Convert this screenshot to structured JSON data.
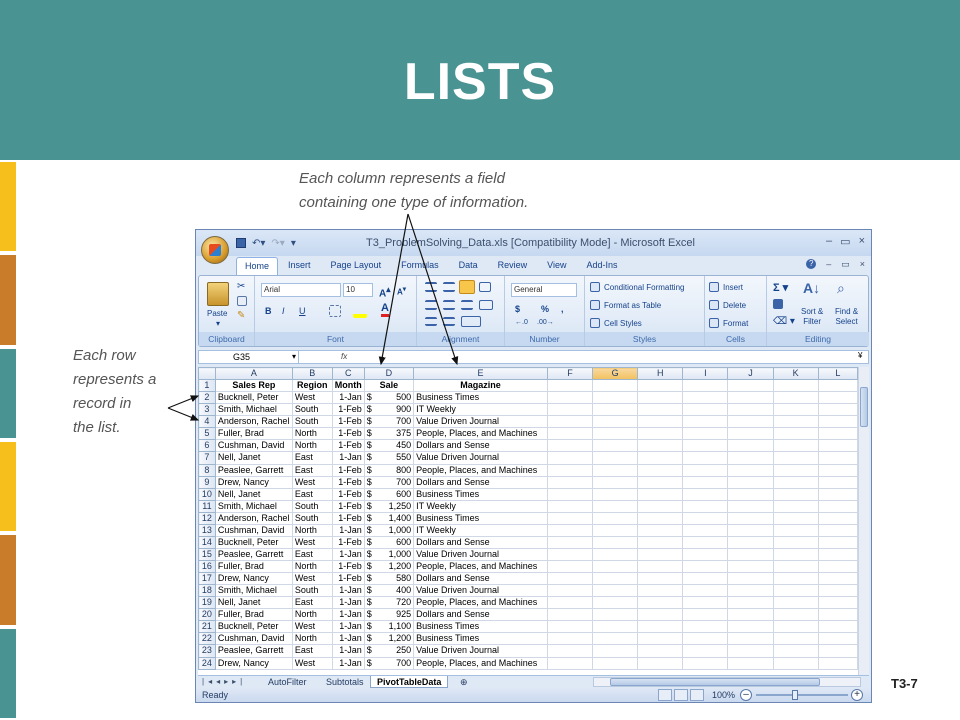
{
  "slide": {
    "title": "LISTS",
    "slide_number": "T3-7",
    "annotation_column": [
      "Each column represents a field",
      "containing one type of information."
    ],
    "annotation_row": [
      "Each row",
      "represents a",
      "record in",
      "the list."
    ],
    "strip_colors": [
      "#f6bf1c",
      "#c97d2b",
      "#4a9393",
      "#f6bf1c",
      "#c97d2b",
      "#4a9393"
    ]
  },
  "window": {
    "title": "T3_ProblemSolving_Data.xls  [Compatibility Mode] - Microsoft Excel",
    "controls": [
      "–",
      "▭",
      "×"
    ]
  },
  "ribbon_tabs": [
    "Home",
    "Insert",
    "Page Layout",
    "Formulas",
    "Data",
    "Review",
    "View",
    "Add-Ins"
  ],
  "ribbon": {
    "clipboard": {
      "label": "Clipboard",
      "paste": "Paste"
    },
    "font": {
      "label": "Font",
      "name": "Arial",
      "size": "10",
      "bold": "B",
      "italic": "I",
      "underline": "U"
    },
    "alignment": {
      "label": "Alignment"
    },
    "number": {
      "label": "Number",
      "format": "General",
      "currency": "$",
      "percent": "%",
      "comma": ","
    },
    "styles": {
      "label": "Styles",
      "items": [
        "Conditional Formatting",
        "Format as Table",
        "Cell Styles"
      ]
    },
    "cells": {
      "label": "Cells",
      "items": [
        "Insert",
        "Delete",
        "Format"
      ]
    },
    "editing": {
      "label": "Editing",
      "sort": [
        "Sort &",
        "Filter"
      ],
      "find": [
        "Find &",
        "Select"
      ]
    }
  },
  "formula_bar": {
    "name_box": "G35",
    "fx": "fx"
  },
  "columns": [
    "A",
    "B",
    "C",
    "D",
    "E",
    "F",
    "G",
    "H",
    "I",
    "J",
    "K",
    "L"
  ],
  "header_row": [
    "Sales Rep",
    "Region",
    "Month",
    "Sale",
    "Magazine"
  ],
  "rows": [
    [
      "Bucknell, Peter",
      "West",
      "1-Jan",
      "500",
      "Business Times"
    ],
    [
      "Smith, Michael",
      "South",
      "1-Feb",
      "900",
      "IT Weekly"
    ],
    [
      "Anderson, Rachel",
      "South",
      "1-Feb",
      "700",
      "Value Driven Journal"
    ],
    [
      "Fuller, Brad",
      "North",
      "1-Feb",
      "375",
      "People, Places, and Machines"
    ],
    [
      "Cushman, David",
      "North",
      "1-Feb",
      "450",
      "Dollars and Sense"
    ],
    [
      "Nell, Janet",
      "East",
      "1-Jan",
      "550",
      "Value Driven Journal"
    ],
    [
      "Peaslee, Garrett",
      "East",
      "1-Feb",
      "800",
      "People, Places, and Machines"
    ],
    [
      "Drew, Nancy",
      "West",
      "1-Feb",
      "700",
      "Dollars and Sense"
    ],
    [
      "Nell, Janet",
      "East",
      "1-Feb",
      "600",
      "Business Times"
    ],
    [
      "Smith, Michael",
      "South",
      "1-Feb",
      "1,250",
      "IT Weekly"
    ],
    [
      "Anderson, Rachel",
      "South",
      "1-Feb",
      "1,400",
      "Business Times"
    ],
    [
      "Cushman, David",
      "North",
      "1-Jan",
      "1,000",
      "IT Weekly"
    ],
    [
      "Bucknell, Peter",
      "West",
      "1-Feb",
      "600",
      "Dollars and Sense"
    ],
    [
      "Peaslee, Garrett",
      "East",
      "1-Jan",
      "1,000",
      "Value Driven Journal"
    ],
    [
      "Fuller, Brad",
      "North",
      "1-Feb",
      "1,200",
      "People, Places, and Machines"
    ],
    [
      "Drew, Nancy",
      "West",
      "1-Feb",
      "580",
      "Dollars and Sense"
    ],
    [
      "Smith, Michael",
      "South",
      "1-Jan",
      "400",
      "Value Driven Journal"
    ],
    [
      "Nell, Janet",
      "East",
      "1-Jan",
      "720",
      "People, Places, and Machines"
    ],
    [
      "Fuller, Brad",
      "North",
      "1-Jan",
      "925",
      "Dollars and Sense"
    ],
    [
      "Bucknell, Peter",
      "West",
      "1-Jan",
      "1,100",
      "Business Times"
    ],
    [
      "Cushman, David",
      "North",
      "1-Jan",
      "1,200",
      "Business Times"
    ],
    [
      "Peaslee, Garrett",
      "East",
      "1-Jan",
      "250",
      "Value Driven Journal"
    ],
    [
      "Drew, Nancy",
      "West",
      "1-Jan",
      "700",
      "People, Places, and Machines"
    ]
  ],
  "currency_symbol": "$",
  "selected_column": "G",
  "sheet_tabs": [
    "AutoFilter",
    "Subtotals",
    "PivotTableData"
  ],
  "active_sheet": "PivotTableData",
  "status": {
    "ready": "Ready",
    "zoom": "100%"
  }
}
